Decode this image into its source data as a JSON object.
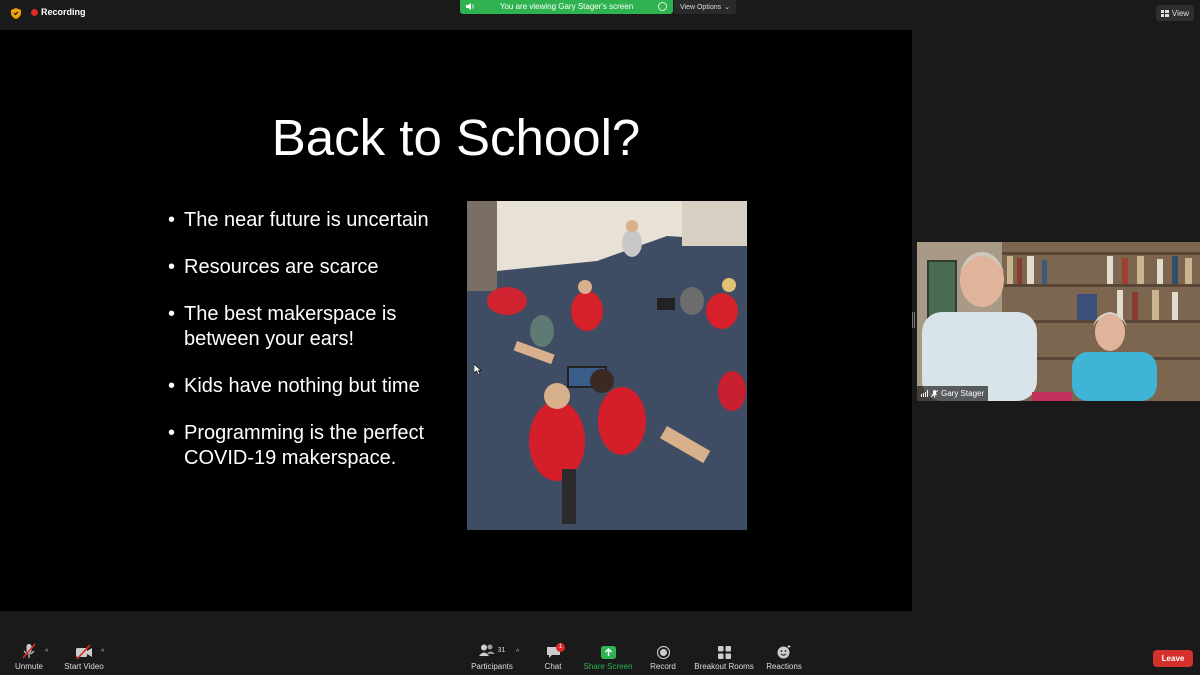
{
  "recording": {
    "label": "Recording"
  },
  "share_banner": {
    "text": "You are viewing Gary Stager's screen"
  },
  "view_options": {
    "label": "View Options"
  },
  "view_button": {
    "label": "View"
  },
  "slide": {
    "title": "Back to School?",
    "bullets": [
      "The near future is uncertain",
      "Resources are scarce",
      "The best makerspace is between your ears!",
      "Kids have nothing but time",
      "Programming is the perfect COVID-19 makerspace."
    ]
  },
  "participant_tile": {
    "name": "Gary Stager"
  },
  "toolbar": {
    "unmute": "Unmute",
    "start_video": "Start Video",
    "participants": "Participants",
    "participants_count": "31",
    "chat": "Chat",
    "chat_badge": "1",
    "share_screen": "Share Screen",
    "record": "Record",
    "breakout_rooms": "Breakout Rooms",
    "reactions": "Reactions",
    "leave": "Leave"
  },
  "colors": {
    "share_green": "#2eb350",
    "recording_red": "#e02828",
    "leave_red": "#d6302c"
  }
}
